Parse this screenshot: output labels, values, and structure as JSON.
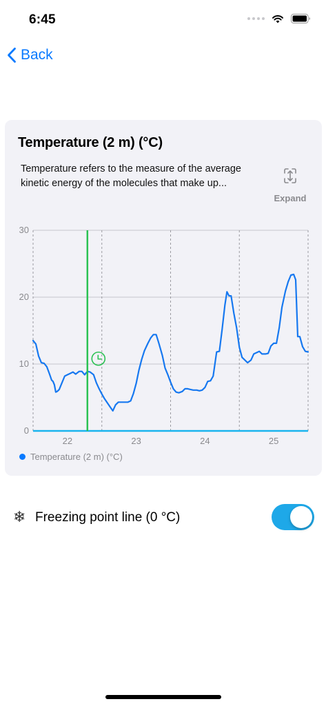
{
  "status": {
    "time": "6:45"
  },
  "nav": {
    "back_label": "Back"
  },
  "card": {
    "title": "Temperature (2 m) (°C)",
    "description": "Temperature refers to the measure of the average kinetic energy of the molecules that make up...",
    "expand_label": "Expand",
    "legend_label": "Temperature (2 m) (°C)"
  },
  "freezing": {
    "label": "Freezing point line (0 °C)",
    "enabled": true
  },
  "colors": {
    "accent": "#0a7aff",
    "series": "#1678f0",
    "cursor": "#2bc253",
    "freezing_line": "#19b4ee",
    "toggle": "#1ea8e8"
  },
  "chart_data": {
    "type": "line",
    "ylim": [
      0,
      30
    ],
    "yticks": [
      "0",
      "10",
      "20",
      "30"
    ],
    "xlim": [
      21.5,
      25.5
    ],
    "xticks": [
      {
        "value": 22,
        "label": "22"
      },
      {
        "value": 23,
        "label": "23"
      },
      {
        "value": 24,
        "label": "24"
      },
      {
        "value": 25,
        "label": "25"
      }
    ],
    "grid": true,
    "freezing_line": 0,
    "cursor_x": 22.29,
    "series": [
      {
        "name": "Temperature (2 m) (°C)",
        "x": [
          21.5,
          21.54,
          21.58,
          21.62,
          21.66,
          21.7,
          21.74,
          21.77,
          21.79,
          21.81,
          21.83,
          21.85,
          21.88,
          21.92,
          21.96,
          22.0,
          22.04,
          22.08,
          22.12,
          22.17,
          22.21,
          22.25,
          22.29,
          22.33,
          22.38,
          22.42,
          22.46,
          22.5,
          22.54,
          22.58,
          22.62,
          22.66,
          22.7,
          22.74,
          22.79,
          22.83,
          22.88,
          22.92,
          22.96,
          23.0,
          23.04,
          23.08,
          23.12,
          23.17,
          23.21,
          23.25,
          23.29,
          23.33,
          23.38,
          23.42,
          23.46,
          23.5,
          23.54,
          23.58,
          23.62,
          23.67,
          23.71,
          23.75,
          23.79,
          23.83,
          23.88,
          23.92,
          23.96,
          24.0,
          24.04,
          24.08,
          24.12,
          24.17,
          24.21,
          24.25,
          24.29,
          24.32,
          24.35,
          24.38,
          24.42,
          24.46,
          24.5,
          24.54,
          24.58,
          24.62,
          24.67,
          24.71,
          24.75,
          24.79,
          24.83,
          24.88,
          24.92,
          24.96,
          25.0,
          25.04,
          25.08,
          25.12,
          25.17,
          25.21,
          25.25,
          25.29,
          25.32,
          25.35,
          25.38,
          25.42,
          25.46,
          25.5
        ],
        "y": [
          13.5,
          13.0,
          11.2,
          10.2,
          10.1,
          9.6,
          8.5,
          7.6,
          7.4,
          6.9,
          5.8,
          5.9,
          6.2,
          7.2,
          8.2,
          8.4,
          8.6,
          8.8,
          8.5,
          8.9,
          8.9,
          8.4,
          8.9,
          8.8,
          8.4,
          7.2,
          6.3,
          5.5,
          4.8,
          4.2,
          3.6,
          3.0,
          3.9,
          4.3,
          4.3,
          4.3,
          4.3,
          4.5,
          5.6,
          7.1,
          9.1,
          10.7,
          12.0,
          13.1,
          13.9,
          14.4,
          14.4,
          13.1,
          11.3,
          9.4,
          8.4,
          7.3,
          6.3,
          5.8,
          5.7,
          5.9,
          6.3,
          6.3,
          6.2,
          6.1,
          6.1,
          6.0,
          6.1,
          6.5,
          7.4,
          7.5,
          8.2,
          11.8,
          11.9,
          15.2,
          18.8,
          20.8,
          20.2,
          20.2,
          17.6,
          15.4,
          12.5,
          11.0,
          10.6,
          10.2,
          10.6,
          11.5,
          11.7,
          11.9,
          11.5,
          11.5,
          11.6,
          12.7,
          13.1,
          13.1,
          15.4,
          18.5,
          20.9,
          22.3,
          23.3,
          23.4,
          22.6,
          14.1,
          14.1,
          12.6,
          11.9,
          11.8
        ]
      }
    ]
  }
}
